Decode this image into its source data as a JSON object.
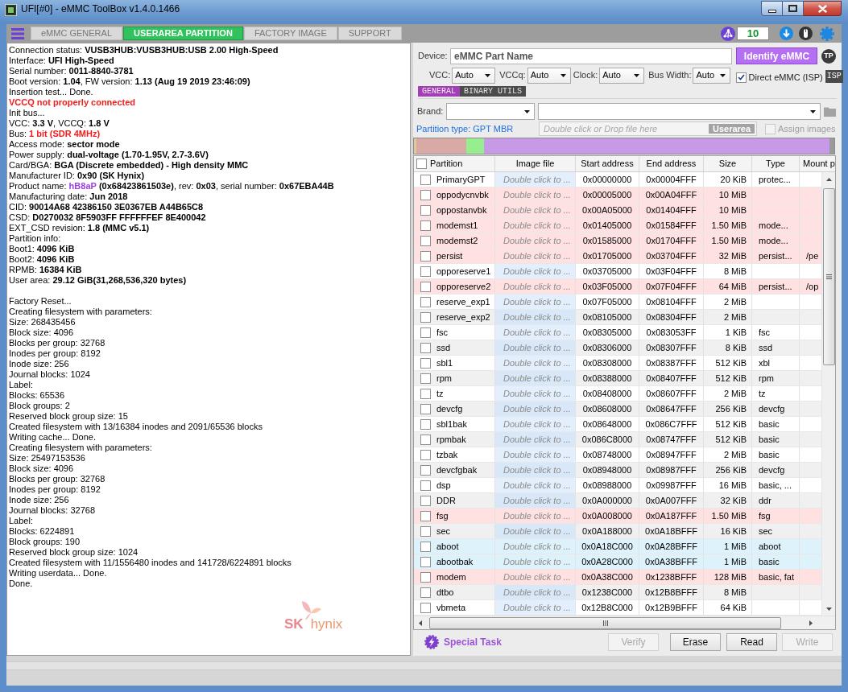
{
  "window": {
    "title": "UFI[#0] - eMMC ToolBox v1.4.0.1466"
  },
  "toolbar": {
    "tabs": [
      {
        "label": "eMMC GENERAL",
        "selected": false
      },
      {
        "label": "USERAREA PARTITION",
        "selected": true
      },
      {
        "label": "FACTORY IMAGE",
        "selected": false
      },
      {
        "label": "SUPPORT",
        "selected": false
      }
    ],
    "counter": "10"
  },
  "log": {
    "sections": [
      {
        "lines": [
          {
            "kind": "text",
            "text": "Connection status: **VUSB3HUB:VUSB3HUB:USB 2.00 High-Speed**"
          },
          {
            "kind": "text",
            "text": "Interface: **UFI High-Speed**"
          },
          {
            "kind": "text",
            "text": "Serial number: **0011-8840-3781**"
          },
          {
            "kind": "text",
            "text": "Boot version: **1.04**, FW version: **1.13 (Aug 19 2019 23:46:09)**"
          },
          {
            "kind": "text",
            "text": "Insertion test... Done."
          },
          {
            "kind": "error",
            "text": "VCCQ not properly connected"
          },
          {
            "kind": "text",
            "text": "Init bus..."
          },
          {
            "kind": "text",
            "text": "VCC: **3.3 V**, VCCQ: **1.8 V**"
          },
          {
            "kind": "alert_value",
            "label": "Bus:",
            "value": "1 bit (SDR 4MHz)"
          },
          {
            "kind": "text",
            "text": "Access mode: **sector mode**"
          },
          {
            "kind": "text",
            "text": "Power supply: **dual-voltage (1.70-1.95V, 2.7-3.6V)**"
          },
          {
            "kind": "text",
            "text": "Card/BGA: **BGA (Discrete embedded) - High density MMC**"
          },
          {
            "kind": "text",
            "text": "Manufacturer ID: **0x90 (SK Hynix)**"
          },
          {
            "kind": "highlight_value",
            "label": "Product name:",
            "value": "hB8aP",
            "rest": "**(0x68423861503e)**, rev: **0x03**, serial number: **0x67EBA44B**"
          },
          {
            "kind": "text",
            "text": "Manufacturing date: **Jun 2018**"
          },
          {
            "kind": "text",
            "text": "CID: **90014A68 42386150 3E0367EB A44B65C8**"
          },
          {
            "kind": "text",
            "text": "CSD: **D0270032 8F5903FF FFFFFFEF 8E400042**"
          },
          {
            "kind": "text",
            "text": "EXT_CSD revision: **1.8 (MMC v5.1)**"
          },
          {
            "kind": "text",
            "text": "Partition info:"
          },
          {
            "kind": "text",
            "text": "Boot1: **4096 KiB**"
          },
          {
            "kind": "text",
            "text": "Boot2: **4096 KiB**"
          },
          {
            "kind": "text",
            "text": "RPMB: **16384 KiB**"
          },
          {
            "kind": "text",
            "text": "User area: **29.12 GiB(31,268,536,320 bytes)**"
          }
        ]
      },
      {
        "lines": [
          {
            "kind": "text",
            "text": "Factory Reset..."
          },
          {
            "kind": "text",
            "text": "Creating filesystem with parameters:"
          },
          {
            "kind": "text",
            "text": "Size: 268435456"
          },
          {
            "kind": "text",
            "text": "Block size: 4096"
          },
          {
            "kind": "text",
            "text": "Blocks per group: 32768"
          },
          {
            "kind": "text",
            "text": "Inodes per group: 8192"
          },
          {
            "kind": "text",
            "text": "Inode size: 256"
          },
          {
            "kind": "text",
            "text": "Journal blocks: 1024"
          },
          {
            "kind": "text",
            "text": "Label:"
          },
          {
            "kind": "text",
            "text": "Blocks: 65536"
          },
          {
            "kind": "text",
            "text": "Block groups: 2"
          },
          {
            "kind": "text",
            "text": "Reserved block group size: 15"
          },
          {
            "kind": "text",
            "text": "Created filesystem with 13/16384 inodes and 2091/65536 blocks"
          },
          {
            "kind": "text",
            "text": "Writing cache... Done."
          },
          {
            "kind": "text",
            "text": "Creating filesystem with parameters:"
          },
          {
            "kind": "text",
            "text": "Size: 25497153536"
          },
          {
            "kind": "text",
            "text": "Block size: 4096"
          },
          {
            "kind": "text",
            "text": "Blocks per group: 32768"
          },
          {
            "kind": "text",
            "text": "Inodes per group: 8192"
          },
          {
            "kind": "text",
            "text": "Inode size: 256"
          },
          {
            "kind": "text",
            "text": "Journal blocks: 32768"
          },
          {
            "kind": "text",
            "text": "Label:"
          },
          {
            "kind": "text",
            "text": "Blocks: 6224891"
          },
          {
            "kind": "text",
            "text": "Block groups: 190"
          },
          {
            "kind": "text",
            "text": "Reserved block group size: 1024"
          },
          {
            "kind": "text",
            "text": "Created filesystem with 11/1556480 inodes and 141728/6224891 blocks"
          },
          {
            "kind": "text",
            "text": "Writing userdata... Done."
          },
          {
            "kind": "text",
            "text": "Done."
          }
        ]
      }
    ],
    "logo": {
      "mark": "SK",
      "name": "hynix"
    }
  },
  "device": {
    "label": "Device:",
    "placeholder": "eMMC Part Name",
    "identify_button": "Identify eMMC",
    "badge": "TP"
  },
  "power": {
    "fields": [
      {
        "label": "VCC:",
        "value": "Auto"
      },
      {
        "label": "VCCq:",
        "value": "Auto"
      },
      {
        "label": "Clock:",
        "value": "Auto"
      },
      {
        "label": "Bus Width:",
        "value": "Auto"
      }
    ],
    "direct_isp": {
      "label": "Direct eMMC (ISP)",
      "checked": true,
      "badge": "ISP"
    }
  },
  "sub_tabs": [
    {
      "label": "GENERAL",
      "selected": true
    },
    {
      "label": "BINARY UTILS",
      "selected": false
    }
  ],
  "brand": {
    "label": "Brand:"
  },
  "partition_type": "Partition type: GPT MBR",
  "image_drop": {
    "placeholder": "Double click or Drop file here",
    "badge": "Userarea"
  },
  "assign_images": {
    "label": "Assign images",
    "checked": false,
    "disabled": true
  },
  "table": {
    "all_checked": false,
    "columns": [
      "Partition",
      "Image file",
      "Start address",
      "End address",
      "Size",
      "Type",
      "Mount p"
    ],
    "rows": [
      {
        "checked": false,
        "partition": "PrimaryGPT",
        "image_file": "Double click to ...",
        "start": "0x00000000",
        "end": "0x00004FFF",
        "size": "20 KiB",
        "type": "protec..."
      },
      {
        "checked": false,
        "partition": "oppodycnvbk",
        "image_file": "Double click to ...",
        "start": "0x00005000",
        "end": "0x00A04FFF",
        "size": "10 MiB",
        "color": "#ffe1e1"
      },
      {
        "checked": false,
        "partition": "oppostanvbk",
        "image_file": "Double click to ...",
        "start": "0x00A05000",
        "end": "0x01404FFF",
        "size": "10 MiB",
        "color": "#ffe1e1"
      },
      {
        "checked": false,
        "partition": "modemst1",
        "image_file": "Double click to ...",
        "start": "0x01405000",
        "end": "0x01584FFF",
        "size": "1.50 MiB",
        "type": "mode...",
        "color": "#ffe1e1"
      },
      {
        "checked": false,
        "partition": "modemst2",
        "image_file": "Double click to ...",
        "start": "0x01585000",
        "end": "0x01704FFF",
        "size": "1.50 MiB",
        "type": "mode...",
        "color": "#ffe1e1"
      },
      {
        "checked": false,
        "partition": "persist",
        "image_file": "Double click to ...",
        "start": "0x01705000",
        "end": "0x03704FFF",
        "size": "32 MiB",
        "type": "persist...",
        "mount": "/pe",
        "color": "#ffe1e1"
      },
      {
        "checked": false,
        "partition": "opporeserve1",
        "image_file": "Double click to ...",
        "start": "0x03705000",
        "end": "0x03F04FFF",
        "size": "8 MiB"
      },
      {
        "checked": false,
        "partition": "opporeserve2",
        "image_file": "Double click to ...",
        "start": "0x03F05000",
        "end": "0x07F04FFF",
        "size": "64 MiB",
        "type": "persist...",
        "mount": "/op",
        "color": "#ffe1e1"
      },
      {
        "checked": false,
        "partition": "reserve_exp1",
        "image_file": "Double click to ...",
        "start": "0x07F05000",
        "end": "0x08104FFF",
        "size": "2 MiB"
      },
      {
        "checked": false,
        "partition": "reserve_exp2",
        "image_file": "Double click to ...",
        "start": "0x08105000",
        "end": "0x08304FFF",
        "size": "2 MiB"
      },
      {
        "checked": false,
        "partition": "fsc",
        "image_file": "Double click to ...",
        "start": "0x08305000",
        "end": "0x083053FF",
        "size": "1 KiB",
        "type": "fsc"
      },
      {
        "checked": false,
        "partition": "ssd",
        "image_file": "Double click to ...",
        "start": "0x08306000",
        "end": "0x08307FFF",
        "size": "8 KiB",
        "type": "ssd"
      },
      {
        "checked": false,
        "partition": "sbl1",
        "image_file": "Double click to ...",
        "start": "0x08308000",
        "end": "0x08387FFF",
        "size": "512 KiB",
        "type": "xbl"
      },
      {
        "checked": false,
        "partition": "rpm",
        "image_file": "Double click to ...",
        "start": "0x08388000",
        "end": "0x08407FFF",
        "size": "512 KiB",
        "type": "rpm"
      },
      {
        "checked": false,
        "partition": "tz",
        "image_file": "Double click to ...",
        "start": "0x08408000",
        "end": "0x08607FFF",
        "size": "2 MiB",
        "type": "tz"
      },
      {
        "checked": false,
        "partition": "devcfg",
        "image_file": "Double click to ...",
        "start": "0x08608000",
        "end": "0x08647FFF",
        "size": "256 KiB",
        "type": "devcfg"
      },
      {
        "checked": false,
        "partition": "sbl1bak",
        "image_file": "Double click to ...",
        "start": "0x08648000",
        "end": "0x086C7FFF",
        "size": "512 KiB",
        "type": "basic"
      },
      {
        "checked": false,
        "partition": "rpmbak",
        "image_file": "Double click to ...",
        "start": "0x086C8000",
        "end": "0x08747FFF",
        "size": "512 KiB",
        "type": "basic"
      },
      {
        "checked": false,
        "partition": "tzbak",
        "image_file": "Double click to ...",
        "start": "0x08748000",
        "end": "0x08947FFF",
        "size": "2 MiB",
        "type": "basic"
      },
      {
        "checked": false,
        "partition": "devcfgbak",
        "image_file": "Double click to ...",
        "start": "0x08948000",
        "end": "0x08987FFF",
        "size": "256 KiB",
        "type": "devcfg"
      },
      {
        "checked": false,
        "partition": "dsp",
        "image_file": "Double click to ...",
        "start": "0x08988000",
        "end": "0x09987FFF",
        "size": "16 MiB",
        "type": "basic, ..."
      },
      {
        "checked": false,
        "partition": "DDR",
        "image_file": "Double click to ...",
        "start": "0x0A000000",
        "end": "0x0A007FFF",
        "size": "32 KiB",
        "type": "ddr"
      },
      {
        "checked": false,
        "partition": "fsg",
        "image_file": "Double click to ...",
        "start": "0x0A008000",
        "end": "0x0A187FFF",
        "size": "1.50 MiB",
        "type": "fsg",
        "color": "#ffe1e1"
      },
      {
        "checked": false,
        "partition": "sec",
        "image_file": "Double click to ...",
        "start": "0x0A188000",
        "end": "0x0A18BFFF",
        "size": "16 KiB",
        "type": "sec"
      },
      {
        "checked": false,
        "partition": "aboot",
        "image_file": "Double click to ...",
        "start": "0x0A18C000",
        "end": "0x0A28BFFF",
        "size": "1 MiB",
        "type": "aboot",
        "color": "#ddf2fa"
      },
      {
        "checked": false,
        "partition": "abootbak",
        "image_file": "Double click to ...",
        "start": "0x0A28C000",
        "end": "0x0A38BFFF",
        "size": "1 MiB",
        "type": "basic",
        "color": "#ddf2fa"
      },
      {
        "checked": false,
        "partition": "modem",
        "image_file": "Double click to ...",
        "start": "0x0A38C000",
        "end": "0x1238BFFF",
        "size": "128 MiB",
        "type": "basic, fat",
        "color": "#ffe1e1"
      },
      {
        "checked": false,
        "partition": "dtbo",
        "image_file": "Double click to ...",
        "start": "0x1238C000",
        "end": "0x12B8BFFF",
        "size": "8 MiB"
      },
      {
        "checked": false,
        "partition": "vbmeta",
        "image_file": "Double click to ...",
        "start": "0x12B8C000",
        "end": "0x12B9BFFF",
        "size": "64 KiB"
      }
    ]
  },
  "special_task": "Special Task",
  "buttons": [
    {
      "label": "Verify",
      "disabled": true
    },
    {
      "label": "Erase",
      "disabled": false
    },
    {
      "label": "Read",
      "disabled": false
    },
    {
      "label": "Write",
      "disabled": true
    }
  ]
}
